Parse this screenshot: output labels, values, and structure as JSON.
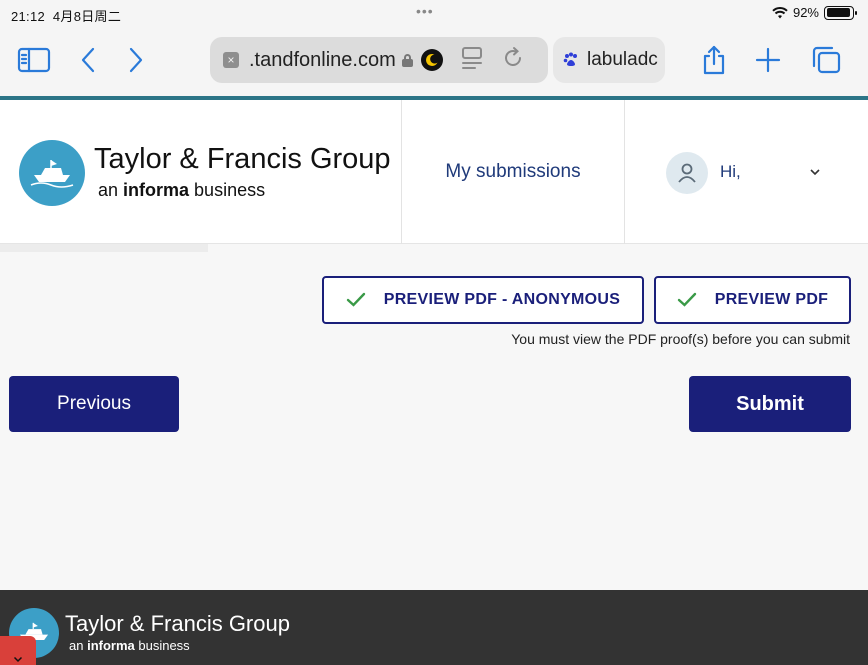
{
  "status_bar": {
    "time": "21:12",
    "date": "4月8日周二",
    "dots": "•••",
    "battery_text": "92%",
    "battery_level": 0.92
  },
  "browser": {
    "url": ".tandfonline.com",
    "second_tab_label": "labuladc",
    "close_tab_glyph": "×"
  },
  "header": {
    "logo_title": "Taylor & Francis Group",
    "logo_sub_prefix": "an ",
    "logo_sub_bold": "informa",
    "logo_sub_suffix": " business",
    "nav_submissions": "My submissions",
    "greeting": "Hi,"
  },
  "actions": {
    "preview_anonymous": "PREVIEW PDF - ANONYMOUS",
    "preview_pdf": "PREVIEW PDF",
    "hint": "You must view the PDF proof(s) before you can submit",
    "previous": "Previous",
    "submit": "Submit"
  },
  "footer": {
    "logo_title": "Taylor & Francis Group",
    "logo_sub_prefix": "an ",
    "logo_sub_bold": "informa",
    "logo_sub_suffix": " business"
  },
  "colors": {
    "accent_blue": "#2a7ad9",
    "brand_navy": "#1a1f7a",
    "teal": "#2c7587",
    "logo_blue": "#3c9fc7",
    "check_green": "#3a9a47",
    "footer_bg": "#333333"
  }
}
